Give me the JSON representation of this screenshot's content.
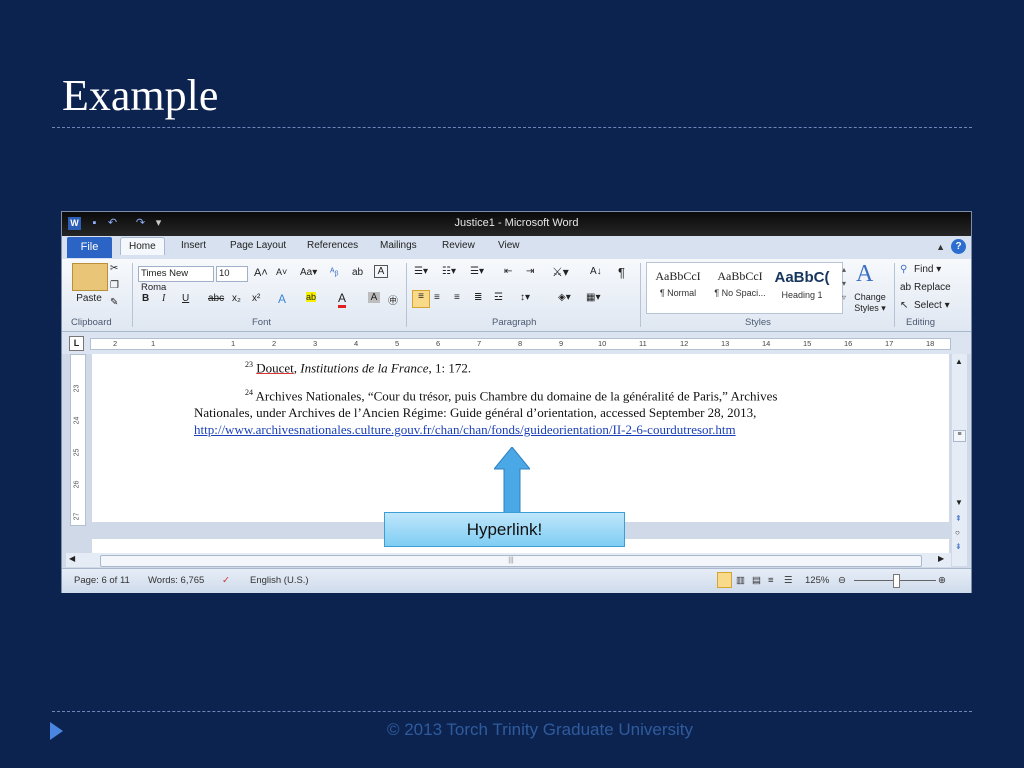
{
  "slide": {
    "title": "Example",
    "footer": "© 2013 Torch Trinity Graduate University"
  },
  "word": {
    "window_title": "Justice1 - Microsoft Word",
    "tabs": [
      "File",
      "Home",
      "Insert",
      "Page Layout",
      "References",
      "Mailings",
      "Review",
      "View"
    ],
    "active_tab": "Home",
    "clipboard": {
      "paste": "Paste",
      "label": "Clipboard"
    },
    "font": {
      "name": "Times New Roma",
      "size": "10",
      "label": "Font",
      "change_case": "Aa▾",
      "bold": "B",
      "italic": "I",
      "underline": "U",
      "strike": "abc",
      "subscript": "x₂",
      "superscript": "x²"
    },
    "paragraph": {
      "label": "Paragraph",
      "pilcrow": "¶"
    },
    "styles": {
      "label": "Styles",
      "items": [
        {
          "preview": "AaBbCcI",
          "name": "¶ Normal"
        },
        {
          "preview": "AaBbCcI",
          "name": "¶ No Spaci..."
        },
        {
          "preview": "AaBbC(",
          "name": "Heading 1"
        }
      ],
      "change_styles": "Change Styles ▾"
    },
    "editing": {
      "label": "Editing",
      "find": "Find ▾",
      "replace": "Replace",
      "select": "Select ▾"
    },
    "ruler_numbers": [
      "2",
      "1",
      "1",
      "2",
      "3",
      "4",
      "5",
      "6",
      "7",
      "8",
      "9",
      "10",
      "11",
      "12",
      "13",
      "14",
      "15",
      "16",
      "17",
      "18"
    ],
    "vruler_numbers": [
      "23",
      "24",
      "25",
      "26",
      "27"
    ],
    "document": {
      "fn23_num": "23",
      "fn23_author": "Doucet",
      "fn23_title": "Institutions de la France",
      "fn23_rest": ", 1: 172.",
      "fn24_num": "24",
      "fn24_line1": "Archives Nationales, “Cour du trésor, puis Chambre du domaine de la généralité de Paris,” Archives",
      "fn24_line2": "Nationales, under Archives de l’Ancien Régime: Guide général d’orientation, accessed September 28, 2013,",
      "fn24_link": "http://www.archivesnationales.culture.gouv.fr/chan/chan/fonds/guideorientation/II-2-6-courdutresor.htm"
    },
    "status": {
      "page": "Page: 6 of 11",
      "words": "Words: 6,765",
      "language": "English (U.S.)",
      "zoom": "125%"
    }
  },
  "callout": {
    "text": "Hyperlink!"
  },
  "colors": {
    "background": "#0c2350",
    "callout": "#8fd3f5",
    "arrow": "#4aa8e6",
    "footer_arrow": "#4a86e0"
  }
}
